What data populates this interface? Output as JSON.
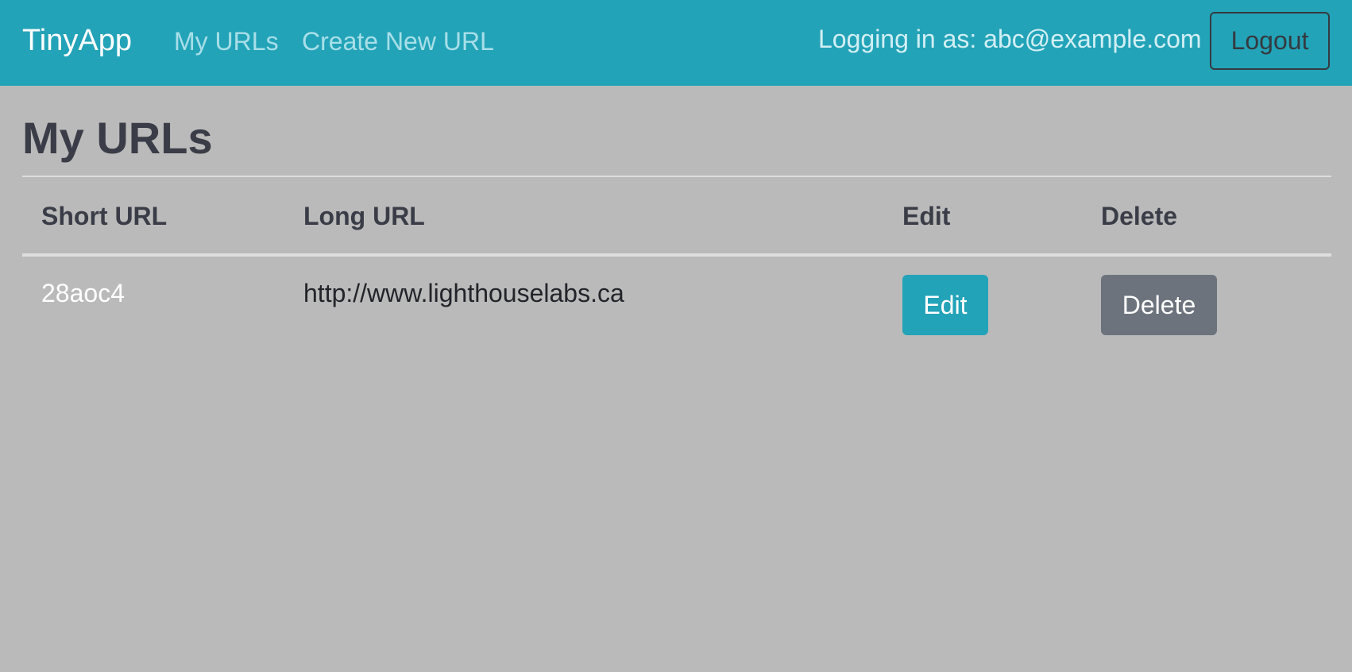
{
  "navbar": {
    "brand": "TinyApp",
    "links": [
      {
        "label": "My URLs"
      },
      {
        "label": "Create New URL"
      }
    ],
    "login_text": "Logging in as: abc@example.com",
    "logout_label": "Logout",
    "colors": {
      "background": "#23a3b8",
      "link": "#a8dfe8"
    }
  },
  "main": {
    "title": "My URLs",
    "table": {
      "headers": [
        "Short URL",
        "Long URL",
        "Edit",
        "Delete"
      ],
      "rows": [
        {
          "short_url": "28aoc4",
          "long_url": "http://www.lighthouselabs.ca",
          "edit_label": "Edit",
          "delete_label": "Delete"
        }
      ]
    }
  },
  "colors": {
    "page_background": "#bababa",
    "edit_button": "#23a3b8",
    "delete_button": "#6c737c"
  }
}
